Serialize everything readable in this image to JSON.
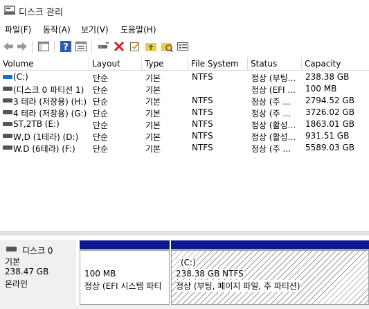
{
  "window": {
    "title": "디스크 관리"
  },
  "menu": [
    "파일(F)",
    "동작(A)",
    "보기(V)",
    "도움말(H)"
  ],
  "toolbar": {
    "icons": [
      "back-arrow-icon",
      "forward-arrow-icon",
      "console-tree-icon",
      "help-icon",
      "properties-icon",
      "connect-icon",
      "delete-icon",
      "check-icon",
      "up-folder-icon",
      "new-folder-icon",
      "settings-panel-icon"
    ]
  },
  "volume_list": {
    "columns": [
      "Volume",
      "Layout",
      "Type",
      "File System",
      "Status",
      "Capacity"
    ],
    "rows": [
      {
        "volume": "(C:)",
        "layout": "단순",
        "type": "기본",
        "fs": "NTFS",
        "status": "정상 (부팅...",
        "capacity": "238.38 GB",
        "icon_color": "#1f6fb5"
      },
      {
        "volume": "(디스크 0 파티션 1)",
        "layout": "단순",
        "type": "기본",
        "fs": "",
        "status": "정상 (EFI ...",
        "capacity": "100 MB",
        "icon_color": "#555555"
      },
      {
        "volume": "3 테라 (저장용) (H:)",
        "layout": "단순",
        "type": "기본",
        "fs": "NTFS",
        "status": "정상 (주 ...",
        "capacity": "2794.52 GB",
        "icon_color": "#555555"
      },
      {
        "volume": "4 테라 (저장용) (G:)",
        "layout": "단순",
        "type": "기본",
        "fs": "NTFS",
        "status": "정상 (주 ...",
        "capacity": "3726.02 GB",
        "icon_color": "#555555"
      },
      {
        "volume": "ST,2TB (E:)",
        "layout": "단순",
        "type": "기본",
        "fs": "NTFS",
        "status": "정상 (활성...",
        "capacity": "1863.01 GB",
        "icon_color": "#555555"
      },
      {
        "volume": "W,D (1테라) (D:)",
        "layout": "단순",
        "type": "기본",
        "fs": "NTFS",
        "status": "정상 (활성...",
        "capacity": "931.51 GB",
        "icon_color": "#555555"
      },
      {
        "volume": "W.D (6테라) (F:)",
        "layout": "단순",
        "type": "기본",
        "fs": "NTFS",
        "status": "정상 (주 ...",
        "capacity": "5589.03 GB",
        "icon_color": "#555555"
      }
    ]
  },
  "graphical": {
    "disk": {
      "name": "디스크 0",
      "kind": "기본",
      "size": "238.47 GB",
      "state": "온라인"
    },
    "partitions": [
      {
        "line1": "",
        "line2": "100 MB",
        "line3": "정상 (EFI 시스템 파티"
      },
      {
        "line1": "(C:)",
        "line2": "238.38 GB NTFS",
        "line3": "정상 (부팅, 페이지 파일, 주 파티션)"
      }
    ],
    "partition_bar_color": "#0b1a8c"
  }
}
